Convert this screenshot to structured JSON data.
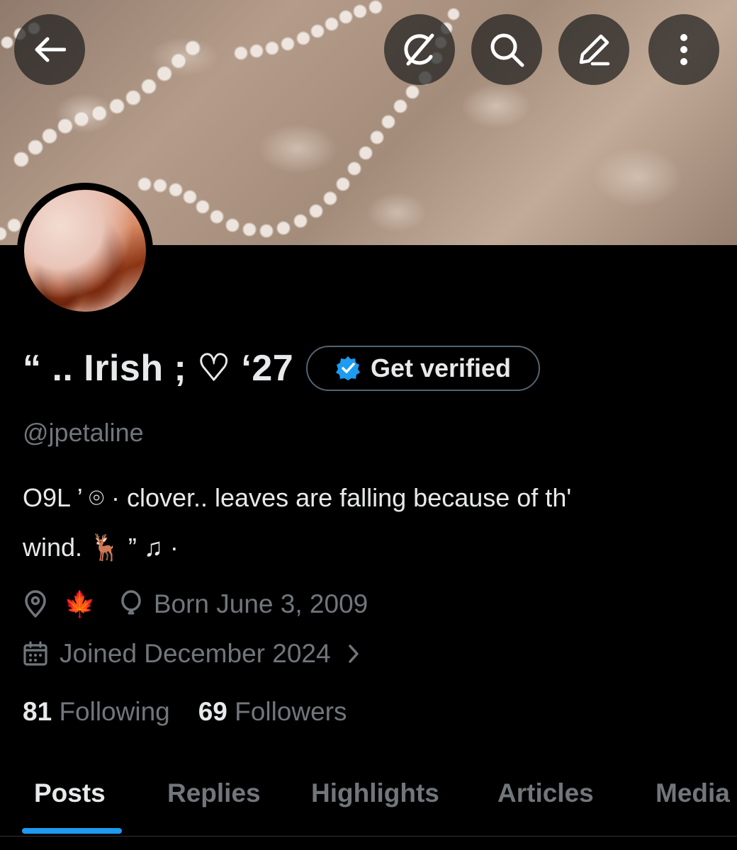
{
  "profile": {
    "display_name": "“ .. Irish ; ♡ ‘27",
    "handle": "@jpetaline",
    "bio_line1": "O9L ’   ⌾ · clover.. leaves are falling    because of th'",
    "bio_line2": "wind.  🦌 ” ♫ ·",
    "location": "🍁",
    "birthday": "Born June 3, 2009",
    "joined": "Joined December 2024",
    "following_count": "81",
    "following_label": "Following",
    "followers_count": "69",
    "followers_label": "Followers"
  },
  "verify": {
    "label": "Get verified",
    "badge_color": "#1d9bf0"
  },
  "header_actions": [
    "back-arrow-icon",
    "grok-icon",
    "search-icon",
    "edit-icon",
    "more-vertical-icon"
  ],
  "tabs": [
    {
      "label": "Posts",
      "active": true
    },
    {
      "label": "Replies",
      "active": false
    },
    {
      "label": "Highlights",
      "active": false
    },
    {
      "label": "Articles",
      "active": false
    },
    {
      "label": "Media",
      "active": false
    }
  ],
  "colors": {
    "background": "#000000",
    "text_primary": "#e7e9ea",
    "text_secondary": "#71767b",
    "accent": "#1d9bf0",
    "border": "#2f3336"
  }
}
